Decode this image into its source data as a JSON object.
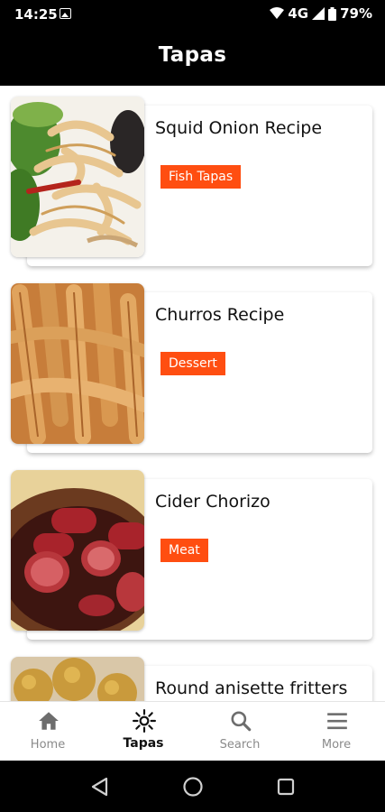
{
  "status": {
    "time": "14:25",
    "network": "4G",
    "battery": "79%"
  },
  "header": {
    "title": "Tapas"
  },
  "recipes": [
    {
      "title": "Squid Onion Recipe",
      "tag": "Fish Tapas",
      "image": "squid-onion-photo"
    },
    {
      "title": "Churros Recipe",
      "tag": "Dessert",
      "image": "churros-photo"
    },
    {
      "title": "Cider Chorizo",
      "tag": "Meat",
      "image": "cider-chorizo-photo"
    },
    {
      "title": "Round anisette fritters",
      "tag": "",
      "image": "anisette-fritters-photo"
    }
  ],
  "nav": {
    "items": [
      {
        "label": "Home",
        "icon": "home-icon"
      },
      {
        "label": "Tapas",
        "icon": "tapas-icon",
        "active": true
      },
      {
        "label": "Search",
        "icon": "search-icon"
      },
      {
        "label": "More",
        "icon": "menu-icon"
      }
    ]
  },
  "colors": {
    "accent": "#ff4e11",
    "header_bg": "#000000"
  }
}
